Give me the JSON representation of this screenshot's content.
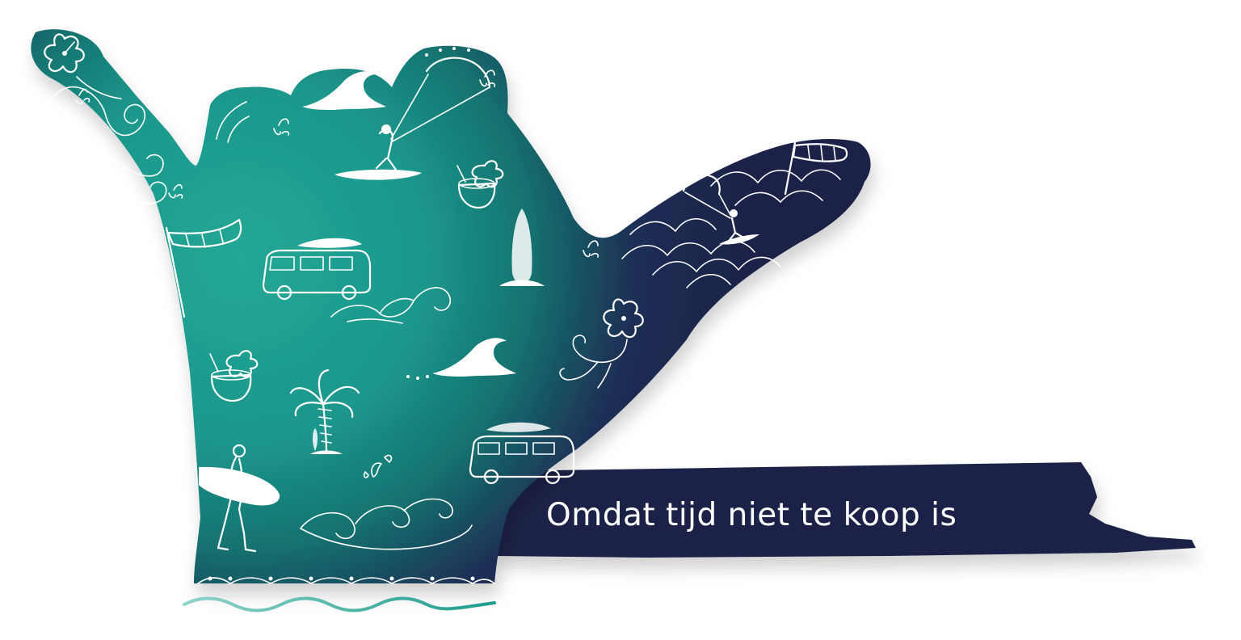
{
  "tagline": "Omdat tijd niet te koop is",
  "colors": {
    "teal_light": "#22a795",
    "teal_dark": "#12726f",
    "navy": "#1f2146",
    "wave_accent": "#2aa896",
    "white": "#ffffff"
  },
  "icons": [
    "hibiscus-icon",
    "wave-icon",
    "kitesurfer-icon",
    "coconut-drink-icon",
    "windsock-icon",
    "camper-van-icon",
    "surfboard-icon",
    "palm-tree-icon",
    "surfer-icon",
    "swirl-icon",
    "splash-icon"
  ]
}
